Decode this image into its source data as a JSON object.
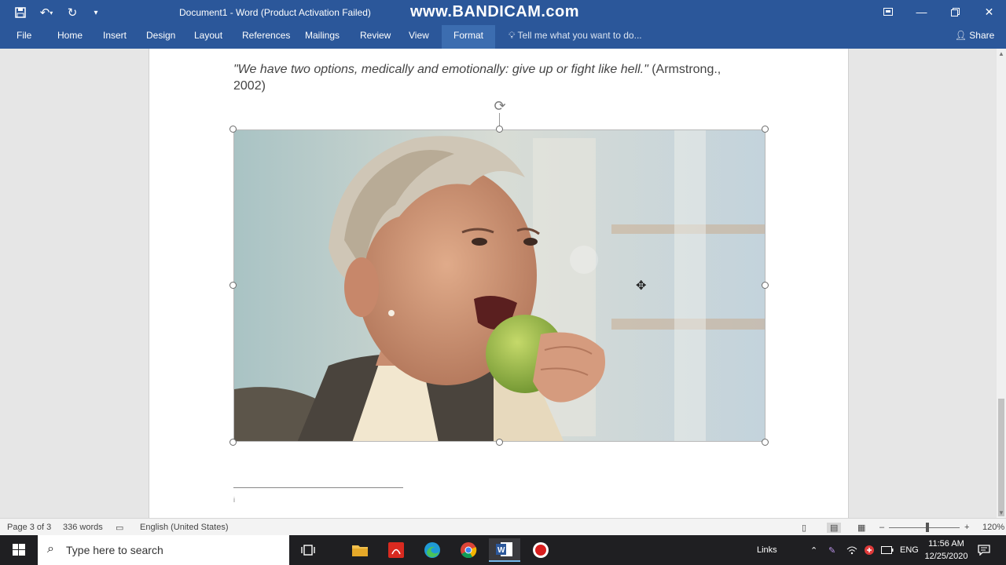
{
  "titlebar": {
    "title": "Document1 - Word (Product Activation Failed)",
    "watermark": "www.BANDICAM.com"
  },
  "ribbon": {
    "tabs": [
      "File",
      "Home",
      "Insert",
      "Design",
      "Layout",
      "References",
      "Mailings",
      "Review",
      "View",
      "Format"
    ],
    "active_tab": "Format",
    "tell_me": "Tell me what you want to do...",
    "share": "Share"
  },
  "document": {
    "quote_italic": "\"We have two options, medically and emotionally: give up or fight like hell.\"",
    "quote_citation": " (Armstrong., 2002)",
    "footnote_marker": "i"
  },
  "statusbar": {
    "page": "Page 3 of 3",
    "words": "336 words",
    "language": "English (United States)",
    "zoom": "120%"
  },
  "taskbar": {
    "search_placeholder": "Type here to search",
    "links": "Links",
    "lang": "ENG",
    "time": "11:56 AM",
    "date": "12/25/2020"
  },
  "colors": {
    "word_blue": "#2b579a",
    "taskbar": "#1f1f22"
  }
}
